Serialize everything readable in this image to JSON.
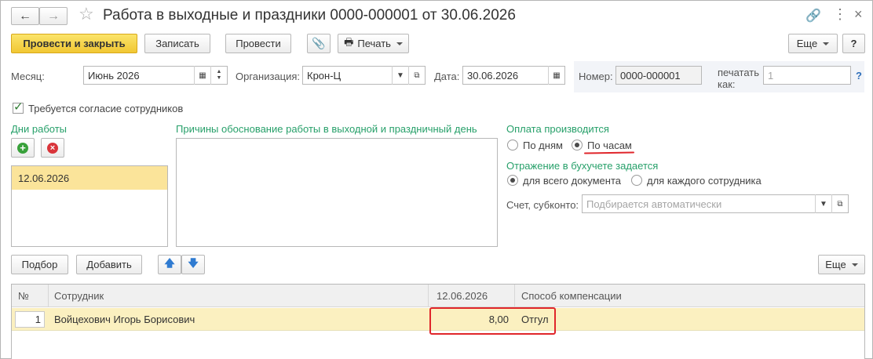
{
  "window": {
    "title": "Работа в выходные и праздники 0000-000001 от 30.06.2026"
  },
  "toolbar": {
    "post_close": "Провести и закрыть",
    "save": "Записать",
    "post": "Провести",
    "print": "Печать",
    "more": "Еще",
    "help": "?"
  },
  "header": {
    "month_label": "Месяц:",
    "month_value": "Июнь 2026",
    "org_label": "Организация:",
    "org_value": "Крон-Ц",
    "date_label": "Дата:",
    "date_value": "30.06.2026",
    "number_label": "Номер:",
    "number_value": "0000-000001",
    "print_as_label_1": "печатать",
    "print_as_label_2": "как:",
    "print_as_value": "1",
    "help_link": "?"
  },
  "consent": {
    "label": "Требуется согласие сотрудников",
    "checked": true
  },
  "work_days": {
    "title": "Дни работы",
    "items": [
      "12.06.2026"
    ]
  },
  "reasons": {
    "title": "Причины обоснование работы в выходной и праздничный день",
    "value": ""
  },
  "payment": {
    "title": "Оплата производится",
    "options": [
      "По дням",
      "По часам"
    ],
    "selected": "По часам"
  },
  "accounting": {
    "title": "Отражение в бухучете задается",
    "options": [
      "для всего документа",
      "для каждого сотрудника"
    ],
    "selected": "для всего документа",
    "account_label": "Счет, субконто:",
    "account_placeholder": "Подбирается автоматически"
  },
  "table_toolbar": {
    "pick": "Подбор",
    "add": "Добавить",
    "more": "Еще"
  },
  "table": {
    "columns": [
      "№",
      "Сотрудник",
      "12.06.2026",
      "Способ компенсации"
    ],
    "rows": [
      {
        "n": "1",
        "employee": "Войцехович Игорь Борисович",
        "hours": "8,00",
        "compensation": "Отгул"
      }
    ]
  },
  "colors": {
    "accent_yellow": "#f6d24a",
    "selected_row": "#fbf0c0",
    "label_green": "#27a06a",
    "highlight_red": "#e0262b"
  }
}
